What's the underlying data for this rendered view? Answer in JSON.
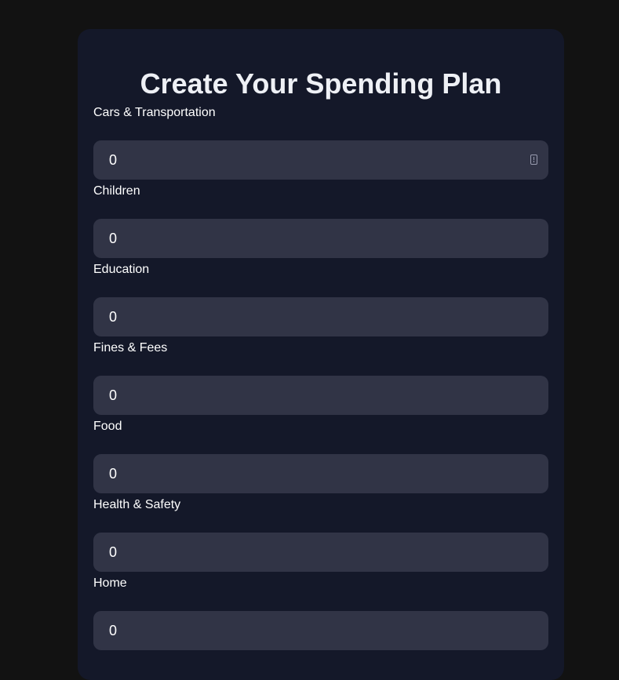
{
  "form": {
    "title": "Create Your Spending Plan",
    "fields": [
      {
        "label": "Cars & Transportation",
        "value": "0"
      },
      {
        "label": "Children",
        "value": "0"
      },
      {
        "label": "Education",
        "value": "0"
      },
      {
        "label": "Fines & Fees",
        "value": "0"
      },
      {
        "label": "Food",
        "value": "0"
      },
      {
        "label": "Health & Safety",
        "value": "0"
      },
      {
        "label": "Home",
        "value": "0"
      }
    ]
  },
  "colors": {
    "page_background": "#121212",
    "card_background": "#141829",
    "input_background": "#313446",
    "text": "#ffffff"
  }
}
